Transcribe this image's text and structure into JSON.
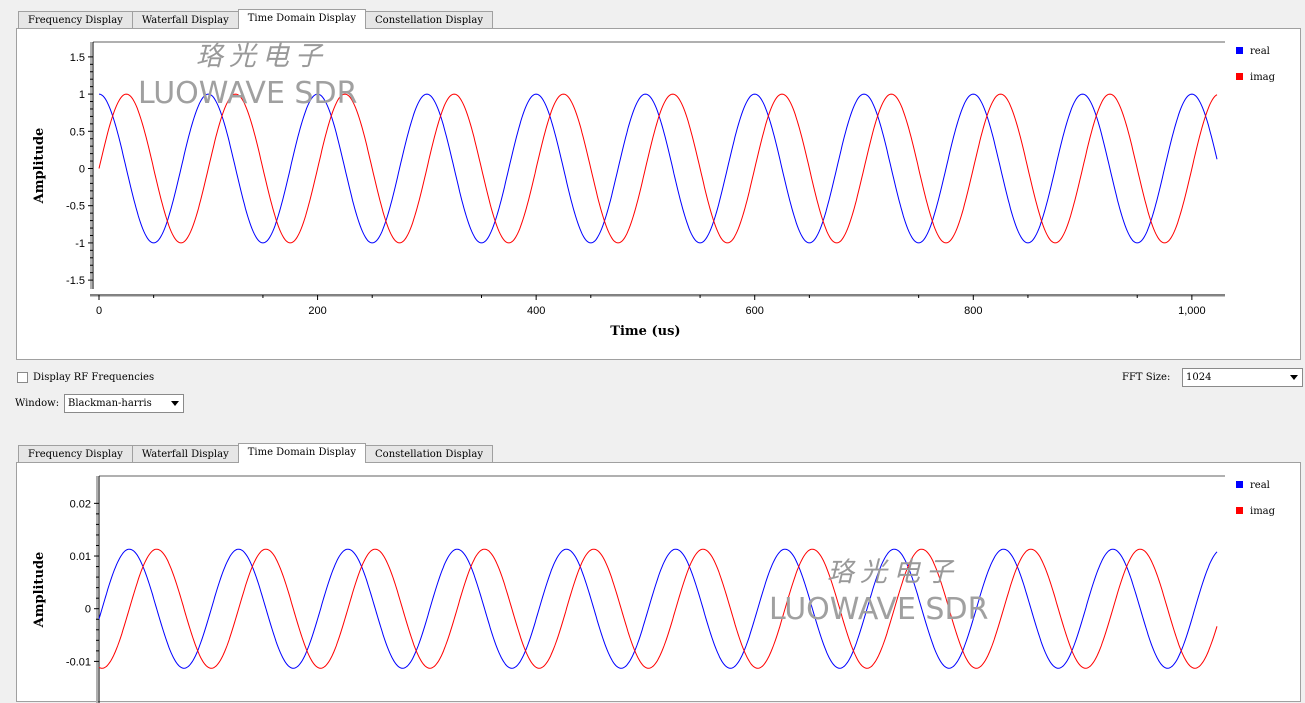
{
  "tabs": [
    "Frequency Display",
    "Waterfall Display",
    "Time Domain Display",
    "Constellation Display"
  ],
  "active_tab": 2,
  "controls": {
    "display_rf_label": "Display RF Frequencies",
    "display_rf_checked": false,
    "fft_size_label": "FFT Size:",
    "fft_size_value": "1024",
    "window_label": "Window:",
    "window_value": "Blackman-harris"
  },
  "watermark": {
    "chinese": "珞光电子",
    "english": "LUOWAVE SDR"
  },
  "colors": {
    "real": "#0000ff",
    "imag": "#ff0000"
  },
  "chart_data": [
    {
      "type": "line",
      "xlabel": "Time (us)",
      "ylabel": "Amplitude",
      "x_range": [
        0,
        1023
      ],
      "xticks": [
        "0",
        "200",
        "400",
        "600",
        "800",
        "1,000"
      ],
      "xtick_values": [
        0,
        200,
        400,
        600,
        800,
        1000
      ],
      "ylim": [
        -1.7,
        1.7
      ],
      "yticks": [
        "1.5",
        "1",
        "0.5",
        "0",
        "-0.5",
        "-1",
        "-1.5"
      ],
      "ytick_values": [
        1.5,
        1,
        0.5,
        0,
        -0.5,
        -1,
        -1.5
      ],
      "legend_position": "top-right",
      "series": [
        {
          "name": "real",
          "function": "cos",
          "amplitude": 1,
          "period_us": 100,
          "phase_deg": 0
        },
        {
          "name": "imag",
          "function": "sin",
          "amplitude": 1,
          "period_us": 100,
          "phase_deg": 0
        }
      ]
    },
    {
      "type": "line",
      "xlabel": "",
      "ylabel": "Amplitude",
      "x_range": [
        0,
        1023
      ],
      "ylim": [
        -0.016,
        0.025
      ],
      "yticks": [
        "0.02",
        "0.01",
        "0",
        "-0.01"
      ],
      "ytick_values": [
        0.02,
        0.01,
        0,
        -0.01
      ],
      "legend_position": "top-right",
      "series": [
        {
          "name": "real",
          "function": "sin",
          "amplitude": 0.0113,
          "period_us": 100,
          "phase_deg": -10
        },
        {
          "name": "imag",
          "function": "sin",
          "amplitude": 0.0113,
          "period_us": 100,
          "phase_deg": -100
        }
      ]
    }
  ]
}
